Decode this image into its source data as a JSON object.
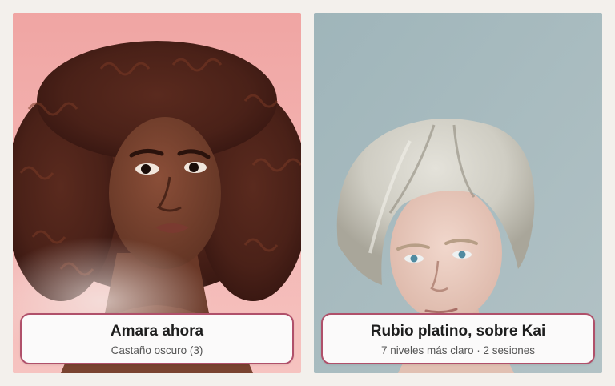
{
  "cards": [
    {
      "title": "Amara ahora",
      "subtitle": "Castaño oscuro (3)",
      "photo_icon": "portrait-curly-dark-brown-hair",
      "background_color": "#f1a9a6"
    },
    {
      "title": "Rubio platino, sobre Kai",
      "subtitle": "7 niveles más claro · 2 sesiones",
      "photo_icon": "portrait-platinum-blonde-bob",
      "background_color": "#a9bbbf"
    }
  ],
  "colors": {
    "page_background": "#f3f0ec",
    "caption_border": "#b0506a",
    "caption_background": "#fbfafa"
  }
}
